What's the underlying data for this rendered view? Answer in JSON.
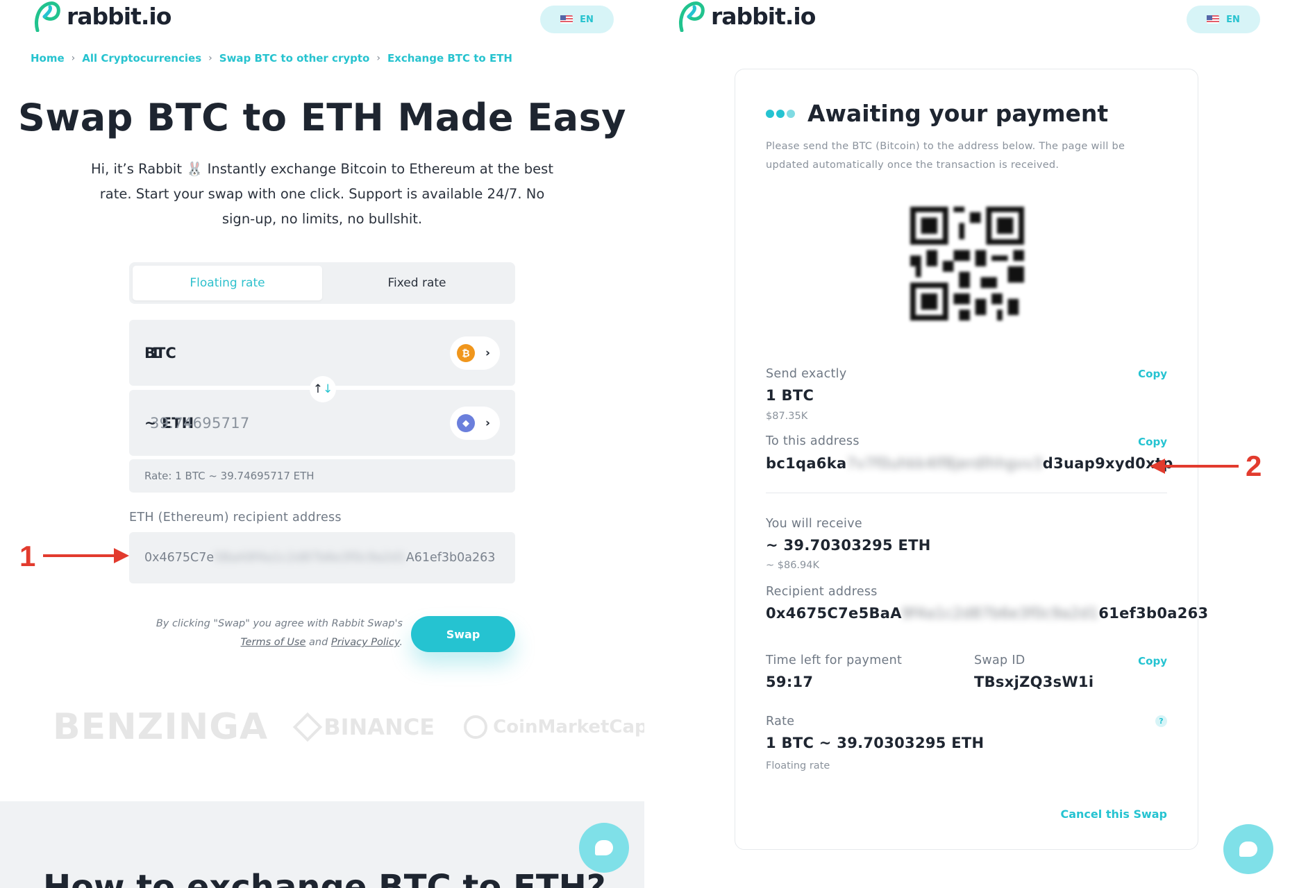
{
  "brand": {
    "name": "rabbit.io",
    "color": "#25c3d1"
  },
  "language": {
    "code": "EN"
  },
  "left": {
    "breadcrumb": [
      "Home",
      "All Cryptocurrencies",
      "Swap BTC to other crypto",
      "Exchange BTC to ETH"
    ],
    "title": "Swap BTC to ETH Made Easy",
    "description": "Hi, it’s Rabbit 🐰 Instantly exchange Bitcoin to Ethereum at the best rate. Start your swap with one click. Support is available 24/7. No sign-up, no limits, no bullshit.",
    "tabs": [
      {
        "label": "Floating rate",
        "active": true
      },
      {
        "label": "Fixed rate",
        "active": false
      }
    ],
    "send": {
      "currency": "BTC",
      "amount": "1",
      "icon": "bitcoin-icon"
    },
    "receive": {
      "prefix": "~ ETH",
      "amount": "39.74695717",
      "icon": "ethereum-icon"
    },
    "rate_text": "Rate: 1 BTC ~ 39.74695717 ETH",
    "recipient": {
      "label": "ETH (Ethereum) recipient address",
      "value_start": "0x4675C7e",
      "value_hidden": "5BaA9f4a1c2d87b6e3f0c9a2d1",
      "value_end": "A61ef3b0a263"
    },
    "terms": {
      "prefix": "By clicking \"Swap\" you agree with Rabbit Swap's",
      "terms_link": "Terms of Use",
      "and": "and",
      "privacy_link": "Privacy Policy",
      "suffix": "."
    },
    "swap_button": "Swap",
    "partners": [
      "BENZINGA",
      "BINANCE",
      "CoinMarketCap"
    ],
    "lower_heading": "How to exchange BTC to ETH?"
  },
  "right": {
    "status_title": "Awaiting your payment",
    "status_desc": "Please send the BTC (Bitcoin) to the address below. The page will be updated automatically once the transaction is received.",
    "send_exactly": {
      "label": "Send exactly",
      "value": "1 BTC",
      "usd": "$87.35K",
      "copy": "Copy"
    },
    "to_address": {
      "label": "To this address",
      "start": "bc1qa6ka",
      "hidden": "7v7f0uhkk4lf8jerdlhhgvv3",
      "end": "d3uap9xyd0xtp",
      "copy": "Copy"
    },
    "you_receive": {
      "label": "You will receive",
      "value": "~ 39.70303295 ETH",
      "usd": "~ $86.94K"
    },
    "recipient": {
      "label": "Recipient address",
      "start": "0x4675C7e5BaA",
      "hidden": "9f4a1c2d87b6e3f0c9a2d1",
      "end": "61ef3b0a263"
    },
    "time_left": {
      "label": "Time left for payment",
      "value": "59:17"
    },
    "swap_id": {
      "label": "Swap ID",
      "value": "TBsxjZQ3sW1i",
      "copy": "Copy"
    },
    "rate": {
      "label": "Rate",
      "value": "1 BTC ~ 39.70303295 ETH",
      "type": "Floating rate",
      "help": "?"
    },
    "cancel": "Cancel this Swap"
  },
  "annotations": [
    {
      "label": "1",
      "color": "#e23b2e"
    },
    {
      "label": "2",
      "color": "#e23b2e"
    }
  ]
}
